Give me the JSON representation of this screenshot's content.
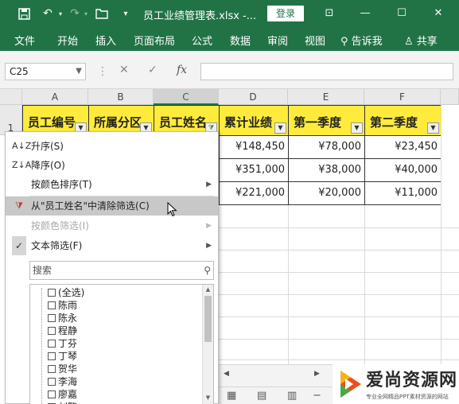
{
  "titlebar": {
    "doc_title": "员工业绩管理表.xlsx  -...",
    "login_label": "登录",
    "save_icon": "save-icon",
    "undo_icon": "undo-icon",
    "redo_icon": "redo-icon",
    "open_icon": "open-folder-icon",
    "customize_icon": "customize-icon",
    "minimize_symbol": "—",
    "maximize_symbol": "☐",
    "close_symbol": "✕",
    "options_symbol": "⊡"
  },
  "menu": {
    "items": [
      "文件",
      "开始",
      "插入",
      "页面布局",
      "公式",
      "数据",
      "审阅",
      "视图"
    ],
    "tell_me": "告诉我",
    "share": "共享"
  },
  "formula_bar": {
    "name_box": "C25",
    "fx_label": "fx",
    "formula_value": ""
  },
  "sheet": {
    "column_headers": [
      "A",
      "B",
      "C",
      "D",
      "E",
      "F"
    ],
    "active_column": "C",
    "row_headers": [
      "1"
    ],
    "header_row": [
      "员工编号",
      "所属分区",
      "员工姓名",
      "累计业绩",
      "第一季度",
      "第二季度"
    ],
    "data_rows": [
      {
        "d": "¥148,450",
        "e": "¥78,000",
        "f": "¥23,450"
      },
      {
        "d": "¥351,000",
        "e": "¥38,000",
        "f": "¥40,000"
      },
      {
        "d": "¥221,000",
        "e": "¥20,000",
        "f": "¥11,000"
      }
    ]
  },
  "filter_menu": {
    "sort_asc": "升序(S)",
    "sort_desc": "降序(O)",
    "sort_by_color": "按颜色排序(T)",
    "clear_filter": "从\"员工姓名\"中清除筛选(C)",
    "filter_by_color": "按颜色筛选(I)",
    "text_filter": "文本筛选(F)",
    "search_placeholder": "搜索",
    "list_items": [
      "(全选)",
      "陈雨",
      "陈永",
      "程静",
      "丁芬",
      "丁琴",
      "贺华",
      "李海",
      "廖嘉",
      "刘繁"
    ]
  },
  "watermark": {
    "title": "爱尚资源网",
    "subtitle": "专业全网精品PPT素材资源的网站"
  },
  "colors": {
    "ribbon_green": "#217346",
    "header_yellow": "#ffeb3b",
    "menu_hover": "#c8c8c8"
  }
}
